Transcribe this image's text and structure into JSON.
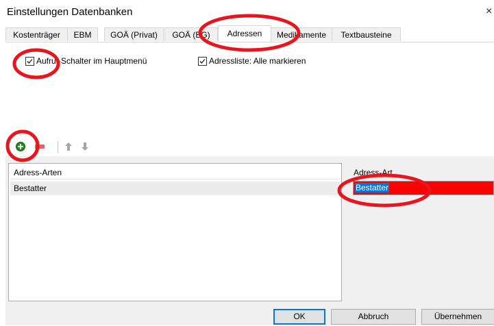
{
  "window": {
    "title": "Einstellungen Datenbanken",
    "close_glyph": "×"
  },
  "tabs": [
    {
      "label": "Kostenträger",
      "active": false
    },
    {
      "label": "EBM",
      "active": false
    },
    {
      "label": "GOÄ (Privat)",
      "active": false
    },
    {
      "label": "GOÄ (BG)",
      "active": false
    },
    {
      "label": "Adressen",
      "active": true
    },
    {
      "label": "Medikamente",
      "active": false
    },
    {
      "label": "Textbausteine",
      "active": false
    }
  ],
  "options": {
    "aufruf_schalter": {
      "label": "Aufruf-Schalter im Hauptmenü",
      "checked": true
    },
    "adressliste": {
      "label": "Adressliste: Alle markieren",
      "checked": true
    }
  },
  "toolbar": {
    "buttons": [
      {
        "icon": "add-green-icon",
        "color": "#1e8c1e"
      },
      {
        "icon": "remove-red-icon",
        "color": "#d9534f"
      },
      {
        "icon": "arrow-up-icon",
        "color": "#9a9a9a"
      },
      {
        "icon": "arrow-down-icon",
        "color": "#9a9a9a"
      }
    ]
  },
  "list": {
    "header": "Adress-Arten",
    "items": [
      "Bestatter"
    ]
  },
  "detail": {
    "label": "Adress-Art",
    "value": "Bestatter",
    "highlight_color": "#ff0000"
  },
  "buttons": {
    "ok": "OK",
    "cancel": "Abbruch",
    "apply": "Übernehmen"
  },
  "annotation_color": "#e8141e"
}
